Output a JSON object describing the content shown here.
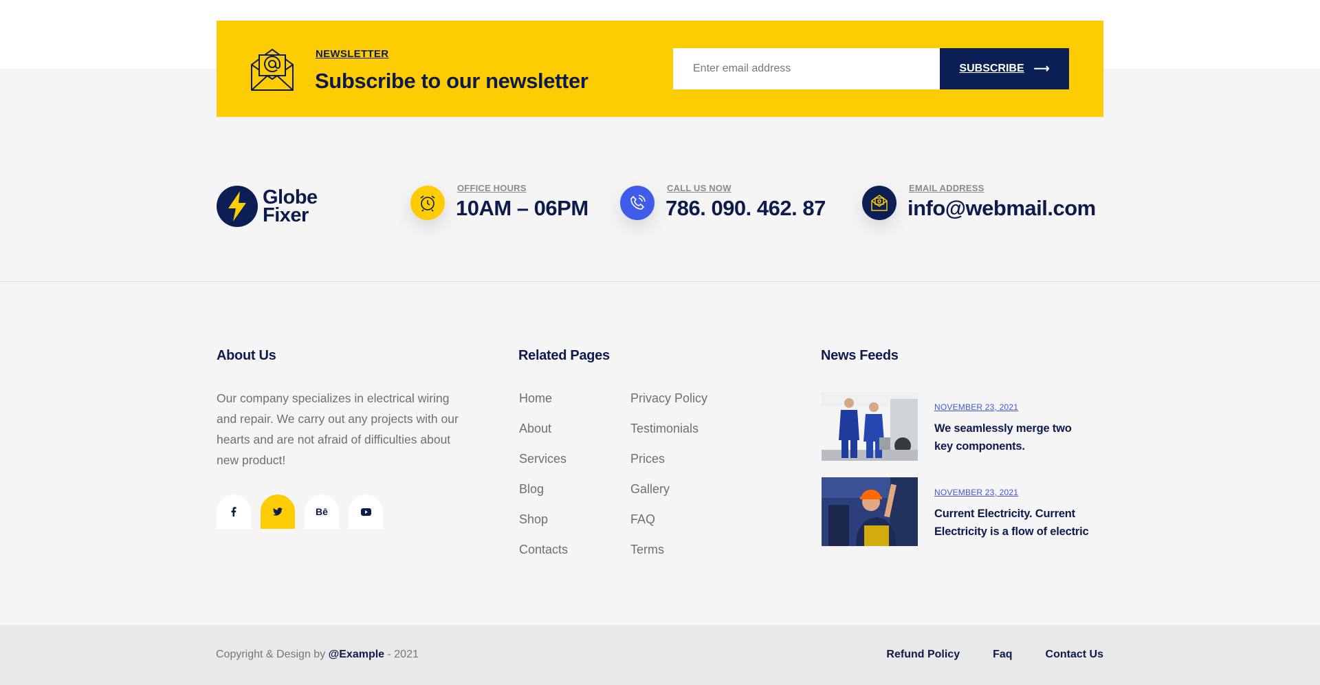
{
  "newsletter": {
    "kicker": "NEWSLETTER",
    "title": "Subscribe to our newsletter",
    "email_placeholder": "Enter email address",
    "subscribe_label": "SUBSCRIBE",
    "arrow": "⟶",
    "icon": "envelope-at-icon"
  },
  "brand": {
    "name_line1": "Globe",
    "name_line2": "Fixer",
    "icon": "lightning-bolt-icon"
  },
  "contact": {
    "hours": {
      "label": "OFFICE HOURS",
      "value": "10AM – 06PM",
      "icon": "alarm-clock-icon",
      "color": "#fdcc03"
    },
    "phone": {
      "label": "CALL US NOW",
      "value": "786. 090. 462. 87",
      "icon": "phone-icon",
      "color": "#3f5ce8"
    },
    "email": {
      "label": "EMAIL ADDRESS",
      "value": "info@webmail.com",
      "icon": "email-icon",
      "color": "#0c1f54"
    }
  },
  "about": {
    "title": "About Us",
    "text": "Our company specializes in electrical wiring and repair. We carry out any projects with our hearts and are not afraid of difficulties about new product!",
    "socials": [
      {
        "label": "f",
        "icon": "facebook-icon"
      },
      {
        "label": "t",
        "icon": "twitter-icon"
      },
      {
        "label": "Bē",
        "icon": "behance-icon"
      },
      {
        "label": "yt",
        "icon": "youtube-icon"
      }
    ]
  },
  "related": {
    "title": "Related Pages",
    "col1": [
      "Home",
      "About",
      "Services",
      "Blog",
      "Shop",
      "Contacts"
    ],
    "col2": [
      "Privacy Policy",
      "Testimonials",
      "Prices",
      "Gallery",
      "FAQ",
      "Terms"
    ]
  },
  "news": {
    "title": "News Feeds",
    "items": [
      {
        "date": "NOVEMBER 23, 2021",
        "title": "We seamlessly merge two key components."
      },
      {
        "date": "NOVEMBER 23, 2021",
        "title": "Current Electricity. Current Electricity is a flow of electric"
      }
    ]
  },
  "footer": {
    "copyright_prefix": "Copyright & Design by ",
    "copyright_brand": "@Example",
    "copyright_suffix": " - 2021",
    "links": [
      "Refund Policy",
      "Faq",
      "Contact Us"
    ]
  }
}
